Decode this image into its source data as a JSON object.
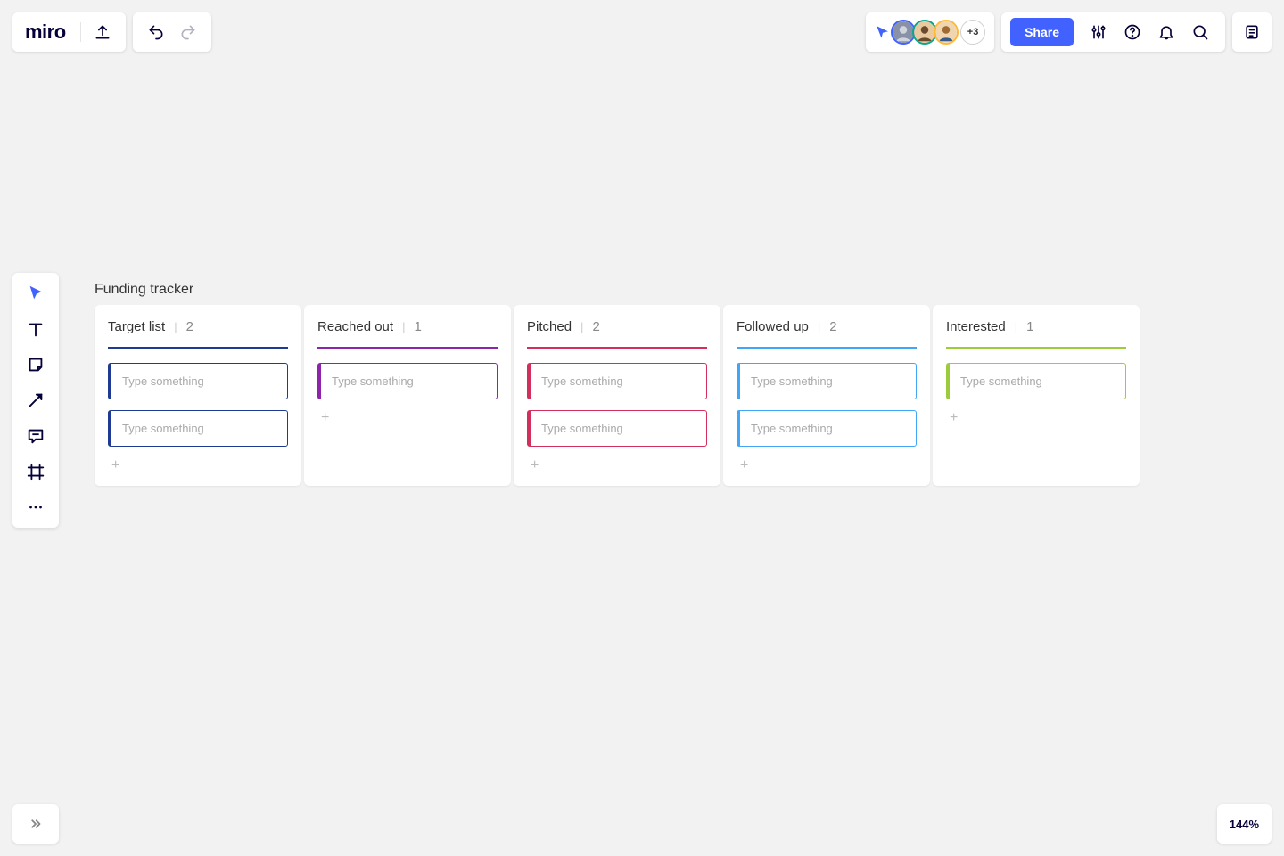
{
  "logo": "miro",
  "collaborators": {
    "overflow": "+3"
  },
  "share_label": "Share",
  "zoom": "144%",
  "board": {
    "title": "Funding tracker",
    "columns": [
      {
        "title": "Target list",
        "count": "2",
        "color": "#1f3a93",
        "cards": [
          {
            "placeholder": "Type something"
          },
          {
            "placeholder": "Type something"
          }
        ]
      },
      {
        "title": "Reached out",
        "count": "1",
        "color": "#8e24aa",
        "cards": [
          {
            "placeholder": "Type something"
          }
        ]
      },
      {
        "title": "Pitched",
        "count": "2",
        "color": "#d32f5d",
        "cards": [
          {
            "placeholder": "Type something"
          },
          {
            "placeholder": "Type something"
          }
        ]
      },
      {
        "title": "Followed up",
        "count": "2",
        "color": "#42a5f5",
        "cards": [
          {
            "placeholder": "Type something"
          },
          {
            "placeholder": "Type something"
          }
        ]
      },
      {
        "title": "Interested",
        "count": "1",
        "color": "#9ccc3c",
        "cards": [
          {
            "placeholder": "Type something"
          }
        ]
      }
    ]
  }
}
